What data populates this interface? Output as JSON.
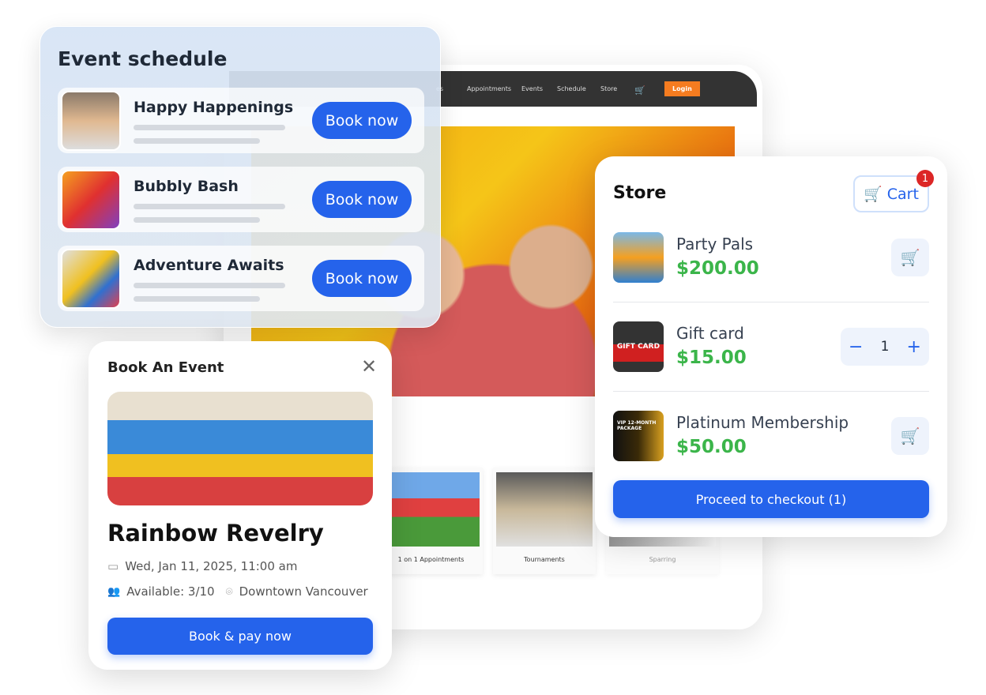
{
  "website": {
    "nav": [
      "es",
      "Appointments",
      "Events",
      "Schedule",
      "Store"
    ],
    "login": "Login",
    "cards": [
      "1 on 1 Appointments",
      "Tournaments",
      "Sparring"
    ]
  },
  "schedule": {
    "title": "Event schedule",
    "events": [
      {
        "name": "Happy Happenings",
        "button": "Book now"
      },
      {
        "name": "Bubbly Bash",
        "button": "Book now"
      },
      {
        "name": "Adventure Awaits",
        "button": "Book now"
      }
    ]
  },
  "booking": {
    "title": "Book An Event",
    "event": "Rainbow Revelry",
    "date": "Wed, Jan 11, 2025, 11:00 am",
    "available": "Available: 3/10",
    "location": "Downtown Vancouver",
    "button": "Book & pay now"
  },
  "store": {
    "title": "Store",
    "cart_label": "Cart",
    "cart_count": "1",
    "items": [
      {
        "name": "Party Pals",
        "price": "$200.00"
      },
      {
        "name": "Gift card",
        "price": "$15.00",
        "quantity": "1",
        "image_text": "GIFT CARD"
      },
      {
        "name": "Platinum Membership",
        "price": "$50.00",
        "image_text": "VIP 12-MONTH PACKAGE"
      }
    ],
    "checkout": "Proceed to checkout (1)"
  },
  "colors": {
    "accent": "#2563eb",
    "price": "#3bb54a",
    "login": "#f57c20",
    "badge": "#dc2626"
  }
}
